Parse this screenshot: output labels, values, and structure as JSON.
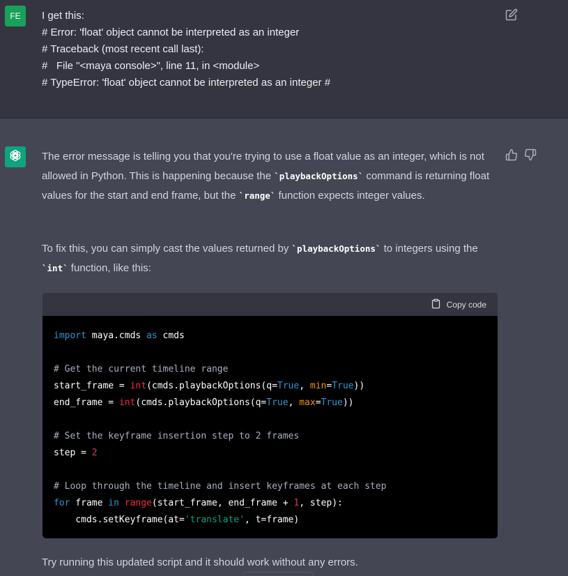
{
  "user_message": {
    "avatar_initials": "FE",
    "lines": [
      "I get this:",
      "# Error: 'float' object cannot be interpreted as an integer",
      "# Traceback (most recent call last):",
      "#   File \"<maya console>\", line 11, in <module>",
      "# TypeError: 'float' object cannot be interpreted as an integer #"
    ]
  },
  "assistant_message": {
    "para1": {
      "t1": "The error message is telling you that you're trying to use a float value as an integer, which is not allowed in Python. This is happening because the ",
      "c1": "`playbackOptions`",
      "t2": " command is returning float values for the start and end frame, but the ",
      "c2": "`range`",
      "t3": " function expects integer values."
    },
    "para2": {
      "t1": "To fix this, you can simply cast the values returned by ",
      "c1": "`playbackOptions`",
      "t2": " to integers using the ",
      "c2": "`int`",
      "t3": " function, like this:"
    },
    "copy_label": "Copy code",
    "code": {
      "l1": {
        "a": "import",
        "b": " maya.cmds ",
        "c": "as",
        "d": " cmds"
      },
      "l3": "# Get the current timeline range",
      "l4": {
        "a": "start_frame = ",
        "b": "int",
        "c": "(cmds.playbackOptions(q=",
        "d": "True",
        "e": ", ",
        "f": "min",
        "g": "=",
        "h": "True",
        "i": "))"
      },
      "l5": {
        "a": "end_frame = ",
        "b": "int",
        "c": "(cmds.playbackOptions(q=",
        "d": "True",
        "e": ", ",
        "f": "max",
        "g": "=",
        "h": "True",
        "i": "))"
      },
      "l7": "# Set the keyframe insertion step to 2 frames",
      "l8": {
        "a": "step = ",
        "b": "2"
      },
      "l10": "# Loop through the timeline and insert keyframes at each step",
      "l11": {
        "a": "for",
        "b": " frame ",
        "c": "in",
        "d": " ",
        "e": "range",
        "f": "(start_frame, end_frame + ",
        "g": "1",
        "h": ", step):"
      },
      "l12": {
        "a": "    cmds.setKeyframe(at=",
        "b": "'translate'",
        "c": ", t=frame)"
      }
    },
    "para3": "Try running this updated script and it should work without any errors."
  },
  "colors": {
    "user_bg": "#343541",
    "assistant_bg": "#444654",
    "user_avatar": "#19a05a",
    "bot_avatar": "#10a37f",
    "code_bg": "#000000",
    "keyword": "#2e95d3",
    "string": "#00a67d",
    "number": "#df3079"
  },
  "icons": {
    "edit": "edit-icon",
    "bot": "openai-logo-icon",
    "thumbs_up": "thumbs-up-icon",
    "thumbs_down": "thumbs-down-icon",
    "copy": "clipboard-icon"
  }
}
